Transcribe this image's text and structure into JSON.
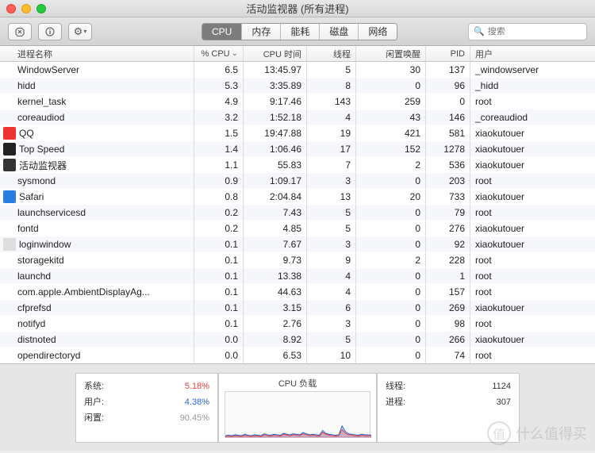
{
  "window": {
    "title": "活动监视器 (所有进程)"
  },
  "toolbar": {
    "tabs": [
      "CPU",
      "内存",
      "能耗",
      "磁盘",
      "网络"
    ],
    "active_tab": 0,
    "search_placeholder": "搜索"
  },
  "columns": {
    "name": "进程名称",
    "cpu": "% CPU",
    "time": "CPU 时间",
    "threads": "线程",
    "wake": "闲置唤醒",
    "pid": "PID",
    "user": "用户"
  },
  "processes": [
    {
      "name": "WindowServer",
      "cpu": "6.5",
      "time": "13:45.97",
      "threads": "5",
      "wake": "30",
      "pid": "137",
      "user": "_windowserver",
      "icon": null
    },
    {
      "name": "hidd",
      "cpu": "5.3",
      "time": "3:35.89",
      "threads": "8",
      "wake": "0",
      "pid": "96",
      "user": "_hidd",
      "icon": null
    },
    {
      "name": "kernel_task",
      "cpu": "4.9",
      "time": "9:17.46",
      "threads": "143",
      "wake": "259",
      "pid": "0",
      "user": "root",
      "icon": null
    },
    {
      "name": "coreaudiod",
      "cpu": "3.2",
      "time": "1:52.18",
      "threads": "4",
      "wake": "43",
      "pid": "146",
      "user": "_coreaudiod",
      "icon": null
    },
    {
      "name": "QQ",
      "cpu": "1.5",
      "time": "19:47.88",
      "threads": "19",
      "wake": "421",
      "pid": "581",
      "user": "xiaokutouer",
      "icon": "qq"
    },
    {
      "name": "Top Speed",
      "cpu": "1.4",
      "time": "1:06.46",
      "threads": "17",
      "wake": "152",
      "pid": "1278",
      "user": "xiaokutouer",
      "icon": "topspeed"
    },
    {
      "name": "活动监视器",
      "cpu": "1.1",
      "time": "55.83",
      "threads": "7",
      "wake": "2",
      "pid": "536",
      "user": "xiaokutouer",
      "icon": "activity"
    },
    {
      "name": "sysmond",
      "cpu": "0.9",
      "time": "1:09.17",
      "threads": "3",
      "wake": "0",
      "pid": "203",
      "user": "root",
      "icon": null
    },
    {
      "name": "Safari",
      "cpu": "0.8",
      "time": "2:04.84",
      "threads": "13",
      "wake": "20",
      "pid": "733",
      "user": "xiaokutouer",
      "icon": "safari"
    },
    {
      "name": "launchservicesd",
      "cpu": "0.2",
      "time": "7.43",
      "threads": "5",
      "wake": "0",
      "pid": "79",
      "user": "root",
      "icon": null
    },
    {
      "name": "fontd",
      "cpu": "0.2",
      "time": "4.85",
      "threads": "5",
      "wake": "0",
      "pid": "276",
      "user": "xiaokutouer",
      "icon": null
    },
    {
      "name": "loginwindow",
      "cpu": "0.1",
      "time": "7.67",
      "threads": "3",
      "wake": "0",
      "pid": "92",
      "user": "xiaokutouer",
      "icon": "login"
    },
    {
      "name": "storagekitd",
      "cpu": "0.1",
      "time": "9.73",
      "threads": "9",
      "wake": "2",
      "pid": "228",
      "user": "root",
      "icon": null
    },
    {
      "name": "launchd",
      "cpu": "0.1",
      "time": "13.38",
      "threads": "4",
      "wake": "0",
      "pid": "1",
      "user": "root",
      "icon": null
    },
    {
      "name": "com.apple.AmbientDisplayAg...",
      "cpu": "0.1",
      "time": "44.63",
      "threads": "4",
      "wake": "0",
      "pid": "157",
      "user": "root",
      "icon": null
    },
    {
      "name": "cfprefsd",
      "cpu": "0.1",
      "time": "3.15",
      "threads": "6",
      "wake": "0",
      "pid": "269",
      "user": "xiaokutouer",
      "icon": null
    },
    {
      "name": "notifyd",
      "cpu": "0.1",
      "time": "2.76",
      "threads": "3",
      "wake": "0",
      "pid": "98",
      "user": "root",
      "icon": null
    },
    {
      "name": "distnoted",
      "cpu": "0.0",
      "time": "8.92",
      "threads": "5",
      "wake": "0",
      "pid": "266",
      "user": "xiaokutouer",
      "icon": null
    },
    {
      "name": "opendirectoryd",
      "cpu": "0.0",
      "time": "6.53",
      "threads": "10",
      "wake": "0",
      "pid": "74",
      "user": "root",
      "icon": null
    }
  ],
  "footer": {
    "system_label": "系统:",
    "system_value": "5.18%",
    "user_label": "用户:",
    "user_value": "4.38%",
    "idle_label": "闲置:",
    "idle_value": "90.45%",
    "chart_title": "CPU 负载",
    "threads_label": "线程:",
    "threads_value": "1124",
    "processes_label": "进程:",
    "processes_value": "307",
    "colors": {
      "system": "#e83e3e",
      "user": "#2a67d8",
      "idle": "#999"
    }
  },
  "watermark": {
    "icon": "值",
    "text": "什么值得买"
  },
  "chart_data": {
    "type": "area",
    "title": "CPU 负载",
    "ylim": [
      0,
      100
    ],
    "series": [
      {
        "name": "系统",
        "color": "#e83e3e",
        "values": [
          3,
          4,
          3,
          5,
          4,
          3,
          6,
          4,
          3,
          5,
          4,
          3,
          7,
          5,
          4,
          6,
          5,
          4,
          8,
          6,
          5,
          7,
          6,
          5,
          9,
          7,
          5,
          6,
          5,
          4,
          12,
          8,
          6,
          5,
          4,
          5,
          18,
          10,
          7,
          6,
          5,
          4,
          6,
          5,
          5,
          4
        ]
      },
      {
        "name": "用户",
        "color": "#2a67d8",
        "values": [
          5,
          6,
          5,
          7,
          6,
          5,
          8,
          6,
          5,
          7,
          6,
          5,
          9,
          7,
          6,
          8,
          7,
          6,
          10,
          8,
          7,
          9,
          8,
          7,
          12,
          9,
          7,
          8,
          7,
          6,
          16,
          10,
          8,
          7,
          6,
          7,
          26,
          14,
          9,
          8,
          7,
          6,
          8,
          7,
          7,
          6
        ]
      }
    ]
  }
}
